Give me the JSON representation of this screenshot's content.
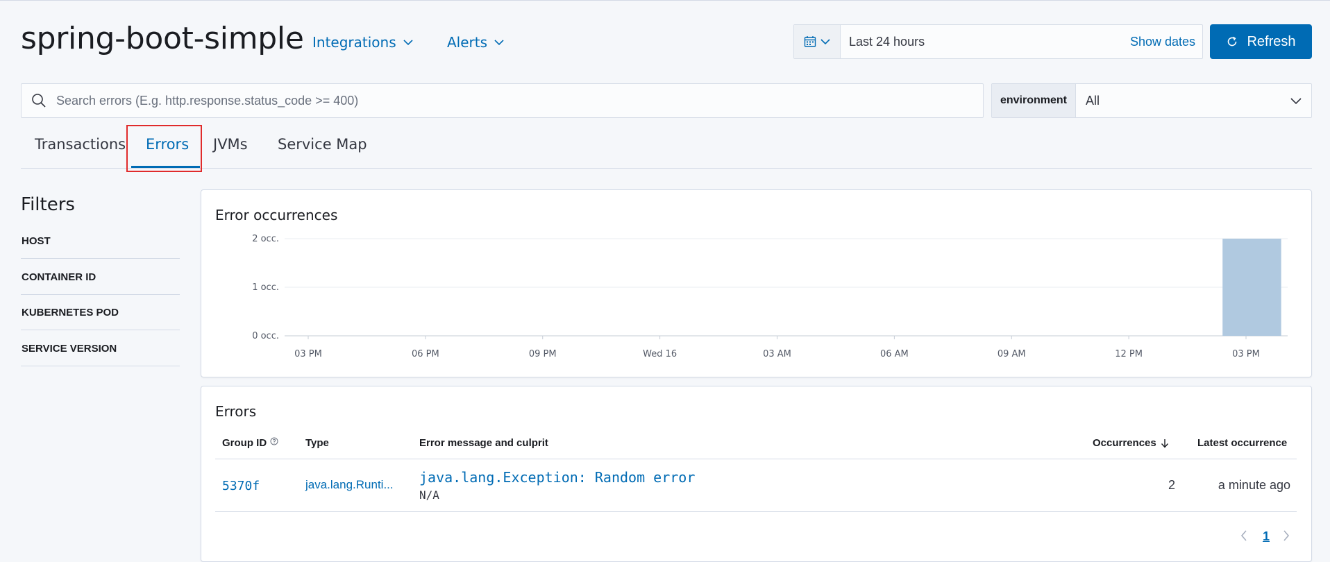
{
  "header": {
    "app_title": "spring-boot-simple",
    "nav": [
      {
        "label": "Integrations"
      },
      {
        "label": "Alerts"
      }
    ],
    "date_range": "Last 24 hours",
    "show_dates": "Show dates",
    "refresh_label": "Refresh"
  },
  "search": {
    "placeholder": "Search errors (E.g. http.response.status_code >= 400)"
  },
  "environment": {
    "label": "environment",
    "value": "All"
  },
  "tabs": [
    {
      "label": "Transactions"
    },
    {
      "label": "Errors",
      "active": true
    },
    {
      "label": "JVMs"
    },
    {
      "label": "Service Map"
    }
  ],
  "filters": {
    "title": "Filters",
    "items": [
      "HOST",
      "CONTAINER ID",
      "KUBERNETES POD",
      "SERVICE VERSION"
    ]
  },
  "error_occurrences": {
    "title": "Error occurrences"
  },
  "chart_data": {
    "type": "bar",
    "title": "Error occurrences",
    "y_tick_labels": [
      "0 occ.",
      "1 occ.",
      "2 occ."
    ],
    "ylim": [
      0,
      2
    ],
    "x_tick_labels": [
      "03 PM",
      "06 PM",
      "09 PM",
      "Wed 16",
      "03 AM",
      "06 AM",
      "09 AM",
      "12 PM",
      "03 PM"
    ],
    "x_hours": [
      0,
      3,
      6,
      9,
      12,
      15,
      18,
      21,
      24
    ],
    "bars": [
      {
        "start_hour": 23.4,
        "end_hour": 24.9,
        "value": 2
      }
    ],
    "grid": true,
    "color": "#b0c9e0"
  },
  "errors_table": {
    "title": "Errors",
    "columns": {
      "group_id": "Group ID",
      "type": "Type",
      "message": "Error message and culprit",
      "occurrences": "Occurrences",
      "latest": "Latest occurrence"
    },
    "rows": [
      {
        "group_id": "5370f",
        "type": "java.lang.Runti...",
        "message": "java.lang.Exception: Random error",
        "culprit": "N/A",
        "occurrences": "2",
        "latest": "a minute ago"
      }
    ],
    "page": "1"
  },
  "colors": {
    "accent": "#006bb4",
    "highlight": "#e02b2b"
  }
}
